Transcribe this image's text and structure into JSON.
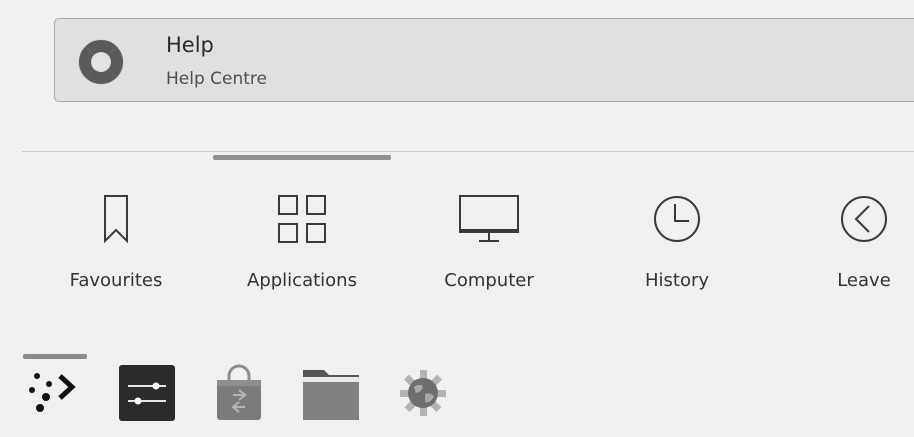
{
  "search_result": {
    "title": "Help",
    "subtitle": "Help Centre",
    "icon": "help-lifebuoy-icon"
  },
  "tabs": [
    {
      "label": "Favourites",
      "icon": "bookmark-icon",
      "active": false
    },
    {
      "label": "Applications",
      "icon": "grid-icon",
      "active": true
    },
    {
      "label": "Computer",
      "icon": "monitor-icon",
      "active": false
    },
    {
      "label": "History",
      "icon": "clock-icon",
      "active": false
    },
    {
      "label": "Leave",
      "icon": "back-arrow-circle-icon",
      "active": false
    }
  ],
  "launcher_bar": [
    {
      "name": "app-launcher",
      "icon": "dots-arrow-icon",
      "active": true
    },
    {
      "name": "system-settings",
      "icon": "sliders-icon",
      "active": false
    },
    {
      "name": "software-store",
      "icon": "shopping-bag-icon",
      "active": false
    },
    {
      "name": "file-manager",
      "icon": "folder-icon",
      "active": false
    },
    {
      "name": "web-browser",
      "icon": "globe-gear-icon",
      "active": false
    }
  ]
}
